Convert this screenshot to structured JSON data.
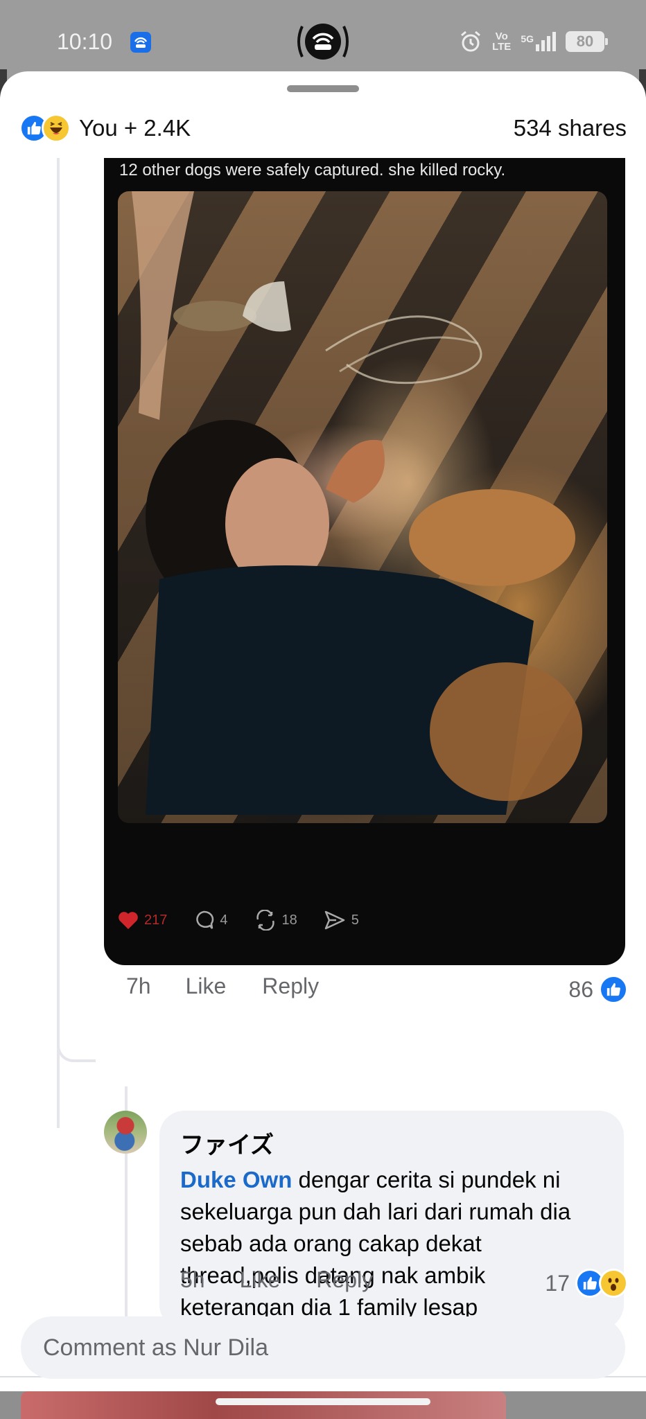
{
  "status_bar": {
    "time": "10:10",
    "volte": "Vo\nLTE",
    "network": "5G",
    "battery": "80"
  },
  "reactions": {
    "summary": "You + 2.4K",
    "shares": "534 shares"
  },
  "embedded_post": {
    "caption": "12 other dogs were safely captured. she killed rocky.",
    "likes": "217",
    "comments": "4",
    "reposts": "18",
    "shares": "5"
  },
  "comment_1": {
    "time": "7h",
    "like_label": "Like",
    "reply_label": "Reply",
    "reaction_count": "86"
  },
  "comment_2": {
    "author": "ファイズ",
    "mention": "Duke Own",
    "text": " dengar cerita si pundek ni sekeluarga pun dah lari dari rumah dia sebab ada orang cakap dekat thread,polis datang nak ambik keterangan dia 1 family lesap",
    "time": "5h",
    "like_label": "Like",
    "reply_label": "Reply",
    "reaction_count": "17"
  },
  "composer": {
    "placeholder": "Comment as Nur Dila"
  },
  "colors": {
    "accent": "#1877f2",
    "mention": "#1b6ac9",
    "bubble": "#f0f2f5",
    "meta_text": "#65676b"
  }
}
